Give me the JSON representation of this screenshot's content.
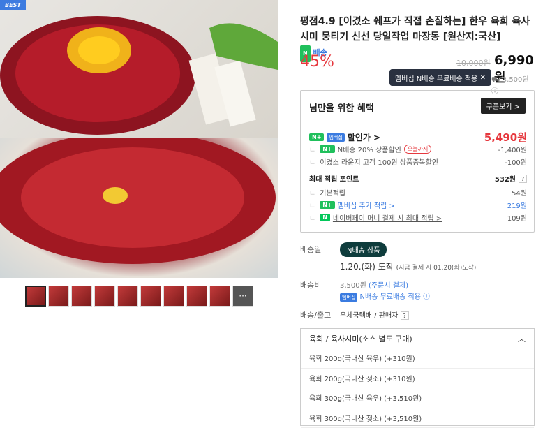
{
  "badge": "BEST",
  "title": "평점4.9 [이겼소 쉐프가 직접 손질하는] 한우 육회 육사시미 뭉티기 신선 당일작업 마장동 [원산지:국산]",
  "delivery_badge": "배송",
  "discount": "45%",
  "orig_price": "10,000원",
  "sale_price": "6,990원",
  "tooltip": "멤버십 N배송 무료배송 적용",
  "ship_orig": "3,500원",
  "benefit": {
    "title": "님만을 위한 혜택",
    "coupon": "쿠폰보기 >",
    "discount_label": "할인가 >",
    "discount_value": "5,490원",
    "n_discount": "N배송 20% 상품할인",
    "today": "오늘까지",
    "n_discount_value": "-1,400원",
    "lounge": "이겼소 라운지 고객 100원 상품중복할인",
    "lounge_value": "-100원",
    "point_label": "최대 적립 포인트",
    "point_value": "532원",
    "base": "기본적립",
    "base_value": "54원",
    "member_extra": "멤버십 추가 적립 >",
    "member_value": "219원",
    "npay": "네이버페이 머니 결제 시 최대 적립 >",
    "npay_value": "109원"
  },
  "ship_date_label": "배송일",
  "ship_tag": "N배송 상품",
  "ship_date": "1.20.(화) 도착",
  "ship_date_note": "(지금 결제 시 01.20(화)도착)",
  "ship_fee_label": "배송비",
  "ship_fee": "3,500원",
  "ship_fee_note": "(주문시 결제)",
  "ship_free": "N배송 무료배송 적용",
  "carrier_label": "배송/출고",
  "carrier": "우체국택배 / 판매자",
  "select": {
    "head": "육회 / 육사시미(소스 별도 구매)",
    "options": [
      "육회 200g(국내산 육우) (+310원)",
      "육회 200g(국내산 젖소) (+310원)",
      "육회 300g(국내산 육우) (+3,510원)",
      "육회 300g(국내산 젖소) (+3,510원)"
    ]
  }
}
